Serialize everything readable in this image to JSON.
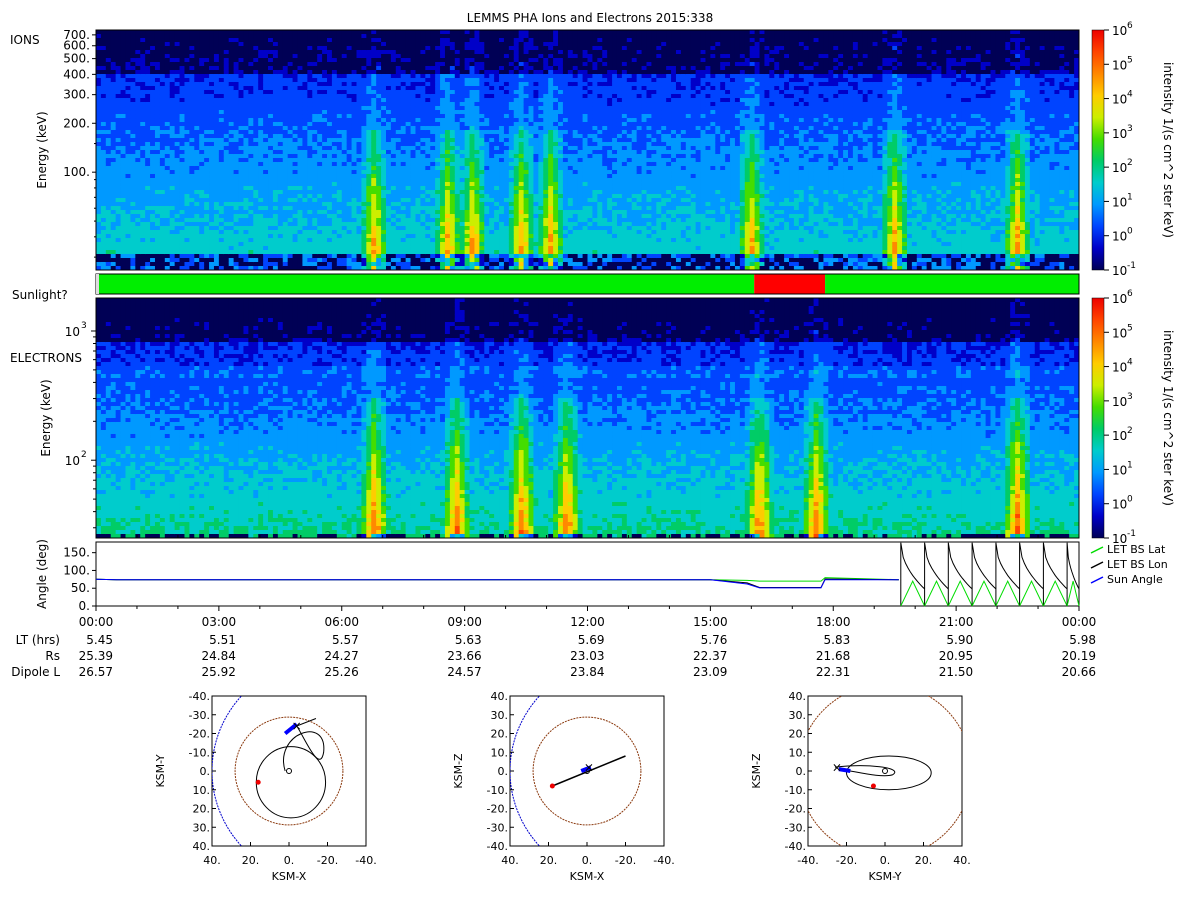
{
  "title": "LEMMS PHA Ions and Electrons  2015:338",
  "colorbar": {
    "label": "intensity 1/(s cm^2 ster keV)",
    "ticks": [
      "10",
      "10",
      "10",
      "10",
      "10",
      "10",
      "10",
      "10"
    ],
    "exponents": [
      "6",
      "5",
      "4",
      "3",
      "2",
      "1",
      "0",
      "-1"
    ],
    "colors": [
      "#000055",
      "#0000c8",
      "#0044ff",
      "#0099ff",
      "#00cccc",
      "#00cc66",
      "#44dd00",
      "#ccee00",
      "#ffcc00",
      "#ff8800",
      "#ff4400",
      "#ee0000"
    ]
  },
  "ions_panel": {
    "tag": "IONS",
    "ylabel": "Energy (keV)",
    "yticks": [
      "700.",
      "600.",
      "500.",
      "400.",
      "300.",
      "200.",
      "100."
    ]
  },
  "sunlight_panel": {
    "label": "Sunlight?",
    "color_sun": "#00ee00",
    "color_shadow": "#ff0000",
    "eclipse_window_hours": [
      16.07,
      17.8
    ]
  },
  "electrons_panel": {
    "tag": "ELECTRONS",
    "ylabel": "Energy (keV)",
    "yticks": [
      "10",
      "10"
    ],
    "ytick_exponents": [
      "3",
      "2"
    ]
  },
  "angle_panel": {
    "ylabel": "Angle (deg)",
    "yticks": [
      "150.",
      "100.",
      "50.",
      "0."
    ],
    "legend": [
      "LET BS Lat",
      "LET BS Lon",
      "Sun Angle"
    ],
    "colors": [
      "#00dd00",
      "#000000",
      "#0000ff"
    ]
  },
  "chart_data": [
    {
      "type": "heatmap",
      "title": "LEMMS PHA Ions and Electrons  2015:338",
      "ylabel": "Energy (keV)",
      "ylim": [
        25,
        750
      ],
      "yscale": "log",
      "colorscale_range": [
        0.1,
        1000000
      ],
      "enhancement_times_hours": [
        6.8,
        8.6,
        9.2,
        10.4,
        11.1,
        16.0,
        19.5,
        22.5
      ]
    },
    {
      "type": "heatmap",
      "ylabel": "Energy (keV)",
      "ylim": [
        25,
        1800
      ],
      "yscale": "log",
      "colorscale_range": [
        0.1,
        1000000
      ],
      "enhancement_times_hours": [
        6.8,
        8.8,
        10.4,
        11.5,
        16.2,
        17.6,
        22.5
      ]
    },
    {
      "type": "line",
      "ylabel": "Angle (deg)",
      "ylim": [
        0,
        180
      ],
      "x_hours": [
        0,
        0.5,
        3,
        6,
        9,
        12,
        15,
        15.9,
        16.2,
        17.7,
        17.8,
        19.6
      ],
      "series": [
        {
          "name": "LET BS Lat",
          "values": [
            75,
            74,
            74,
            74,
            74,
            74,
            74,
            72,
            70,
            70,
            80,
            74
          ]
        },
        {
          "name": "LET BS Lon",
          "values": [
            75,
            74,
            74,
            74,
            74,
            74,
            74,
            65,
            52,
            52,
            76,
            74
          ]
        },
        {
          "name": "Sun Angle",
          "values": [
            75,
            74,
            74,
            74,
            74,
            74,
            74,
            62,
            51,
            51,
            74,
            74
          ]
        }
      ],
      "spin_period_hours": 0.58
    },
    {
      "type": "table",
      "xticks": [
        "00:00",
        "03:00",
        "06:00",
        "09:00",
        "12:00",
        "15:00",
        "18:00",
        "21:00",
        "00:00"
      ],
      "rows": [
        {
          "label": "LT (hrs)",
          "values": [
            "5.45",
            "5.51",
            "5.57",
            "5.63",
            "5.69",
            "5.76",
            "5.83",
            "5.90",
            "5.98"
          ]
        },
        {
          "label": "Rs",
          "values": [
            "25.39",
            "24.84",
            "24.27",
            "23.66",
            "23.03",
            "22.37",
            "21.68",
            "20.95",
            "20.19"
          ]
        },
        {
          "label": "Dipole L",
          "values": [
            "26.57",
            "25.92",
            "25.26",
            "24.57",
            "23.84",
            "23.09",
            "22.31",
            "21.50",
            "20.66"
          ]
        }
      ]
    }
  ],
  "orbit_plots": [
    {
      "xlabel": "KSM-X",
      "ylabel": "KSM-Y",
      "xticks": [
        "40.",
        "20.",
        "0.",
        "-20.",
        "-40."
      ],
      "yticks": [
        "-40.",
        "-30.",
        "-20.",
        "-10.",
        "0.",
        "10.",
        "20.",
        "30.",
        "40."
      ],
      "xrange": [
        40,
        -40
      ],
      "yrange": [
        -40,
        40
      ]
    },
    {
      "xlabel": "KSM-X",
      "ylabel": "KSM-Z",
      "xticks": [
        "40.",
        "20.",
        "0.",
        "-20.",
        "-40."
      ],
      "yticks": [
        "40.",
        "30.",
        "20.",
        "10.",
        "0.",
        "-10.",
        "-20.",
        "-30.",
        "-40."
      ],
      "xrange": [
        40,
        -40
      ],
      "yrange": [
        40,
        -40
      ]
    },
    {
      "xlabel": "KSM-Y",
      "ylabel": "KSM-Z",
      "xticks": [
        "-40.",
        "-20.",
        "0.",
        "20.",
        "40."
      ],
      "yticks": [
        "40.",
        "30.",
        "20.",
        "10.",
        "0.",
        "-10.",
        "-20.",
        "-30.",
        "-40."
      ],
      "xrange": [
        -40,
        40
      ],
      "yrange": [
        40,
        -40
      ]
    }
  ]
}
